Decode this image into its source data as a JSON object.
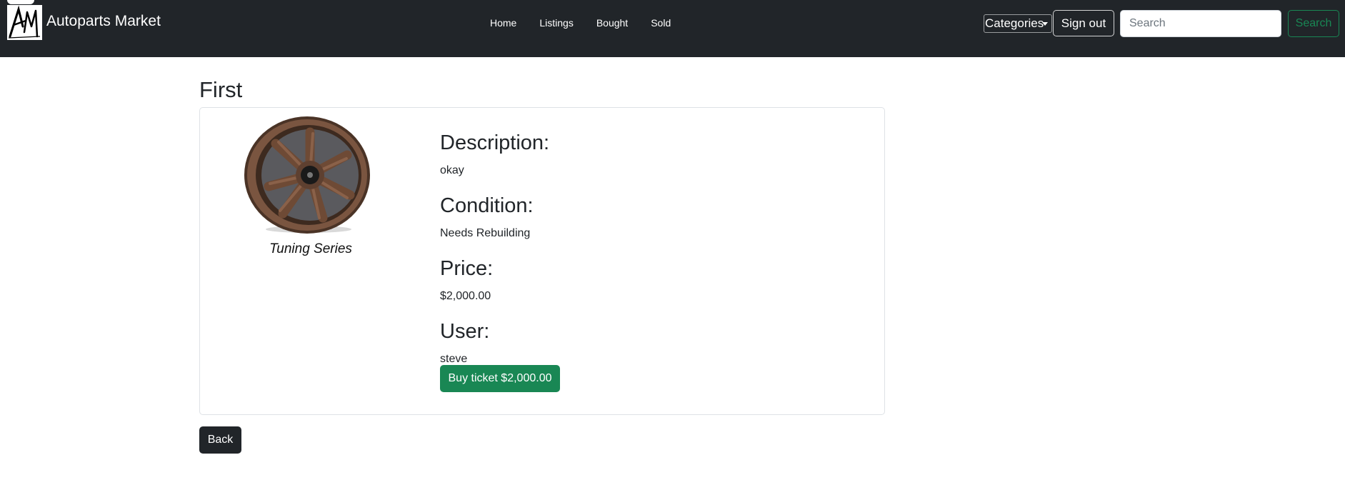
{
  "navbar": {
    "brand_name": "Autoparts Market",
    "logo_text": "AM",
    "links": [
      "Home",
      "Listings",
      "Bought",
      "Sold"
    ],
    "categories_label": "Categories",
    "signout_label": "Sign out",
    "search_placeholder": "Search",
    "search_button_label": "Search"
  },
  "listing": {
    "title": "First",
    "image_caption": "Tuning Series",
    "description_label": "Description:",
    "description_value": "okay",
    "condition_label": "Condition:",
    "condition_value": "Needs Rebuilding",
    "price_label": "Price:",
    "price_value": "$2,000.00",
    "user_label": "User:",
    "user_value": "steve",
    "buy_button_label": "Buy ticket $2,000.00"
  },
  "back_button_label": "Back",
  "colors": {
    "navbar_bg": "#212529",
    "success": "#198754",
    "dark_button": "#212529",
    "wheel_bronze": "#6b4a35"
  },
  "icons": {
    "logo": "autoparts-market-logo",
    "dropdown_caret": "caret-down-icon",
    "product_image": "alloy-wheel-image"
  }
}
